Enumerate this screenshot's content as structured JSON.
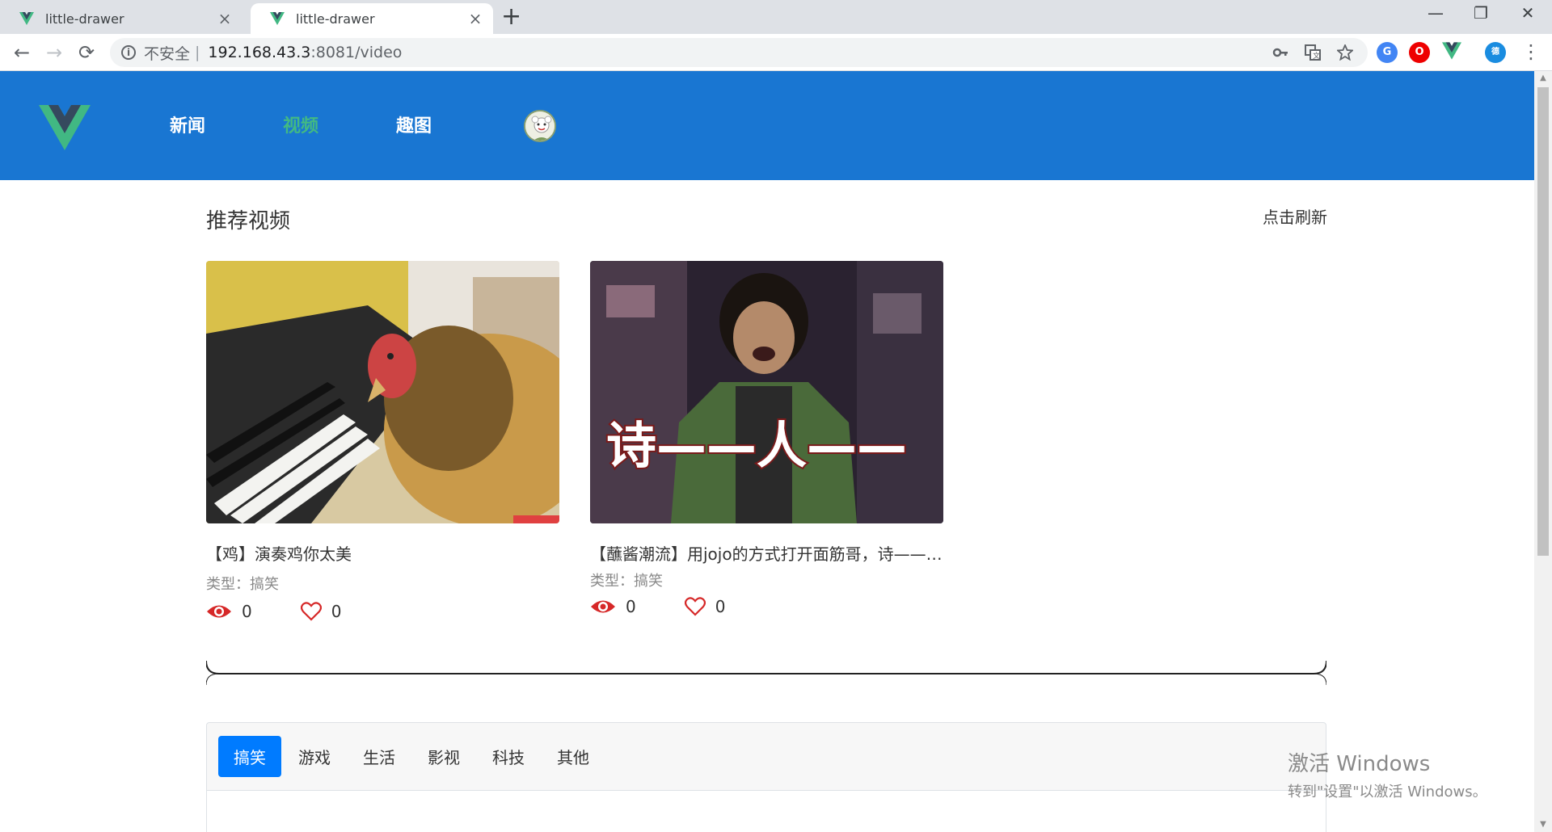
{
  "browser": {
    "tabs": [
      {
        "title": "little-drawer",
        "active": false
      },
      {
        "title": "little-drawer",
        "active": true
      }
    ],
    "new_tab": "+",
    "window_controls": {
      "minimize": "—",
      "restore": "❐",
      "close": "✕"
    },
    "nav": {
      "back": "←",
      "forward": "→",
      "reload": "⟳"
    },
    "security_label": "不安全",
    "separator": "|",
    "url_host": "192.168.43.3",
    "url_rest": ":8081/video",
    "extensions": [
      "key-icon",
      "translate-icon",
      "star-icon",
      "google-translate-ext",
      "opera-ext",
      "vue-devtools-ext",
      "profile-ext"
    ]
  },
  "navbar": {
    "links": [
      {
        "label": "新闻",
        "active": false
      },
      {
        "label": "视频",
        "active": true
      },
      {
        "label": "趣图",
        "active": false
      }
    ],
    "brand_color": "#1976d2",
    "active_color": "#42b983"
  },
  "main": {
    "section_title": "推荐视频",
    "refresh_label": "点击刷新",
    "videos": [
      {
        "title": "【鸡】演奏鸡你太美",
        "type_label": "类型：搞笑",
        "views": "0",
        "likes": "0"
      },
      {
        "title": "【蘸酱潮流】用jojo的方式打开面筋哥，诗——人——",
        "type_label": "类型：搞笑",
        "views": "0",
        "likes": "0",
        "overlay_text": "诗——人——"
      }
    ]
  },
  "category_tabs": {
    "items": [
      "搞笑",
      "游戏",
      "生活",
      "影视",
      "科技",
      "其他"
    ],
    "active": "搞笑",
    "active_color": "#007bff"
  },
  "watermark": {
    "line1": "激活 Windows",
    "line2": "转到\"设置\"以激活 Windows。"
  }
}
